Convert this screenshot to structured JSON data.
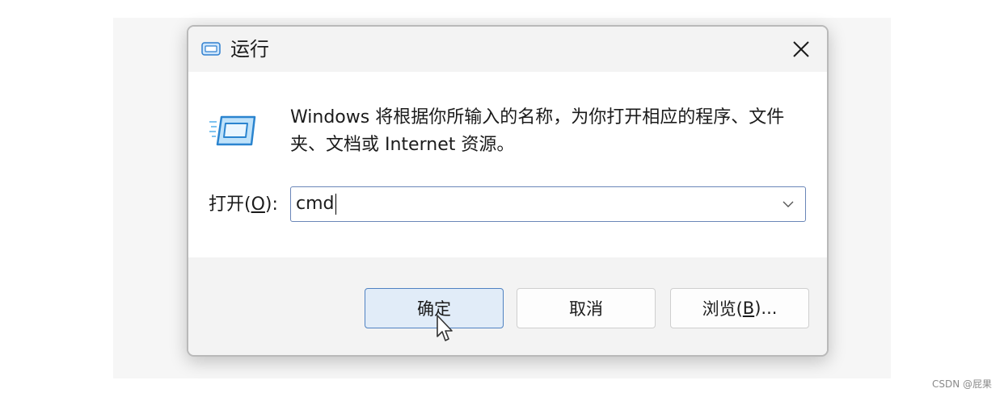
{
  "dialog": {
    "title": "运行",
    "title_icon": "run-icon",
    "close_icon": "close-icon",
    "description": "Windows 将根据你所输入的名称，为你打开相应的程序、文件夹、文档或 Internet 资源。",
    "open_label_prefix": "打开(",
    "open_label_accel": "O",
    "open_label_suffix": "):",
    "input_value": "cmd",
    "dropdown_icon": "chevron-down-icon",
    "buttons": {
      "ok": "确定",
      "cancel": "取消",
      "browse_prefix": "浏览(",
      "browse_accel": "B",
      "browse_suffix": ")..."
    }
  },
  "watermark": "CSDN @屁果",
  "colors": {
    "accent": "#4f82c2",
    "ok_fill": "#e1ecf8",
    "dialog_bg": "#f3f3f3",
    "content_bg": "#ffffff"
  }
}
